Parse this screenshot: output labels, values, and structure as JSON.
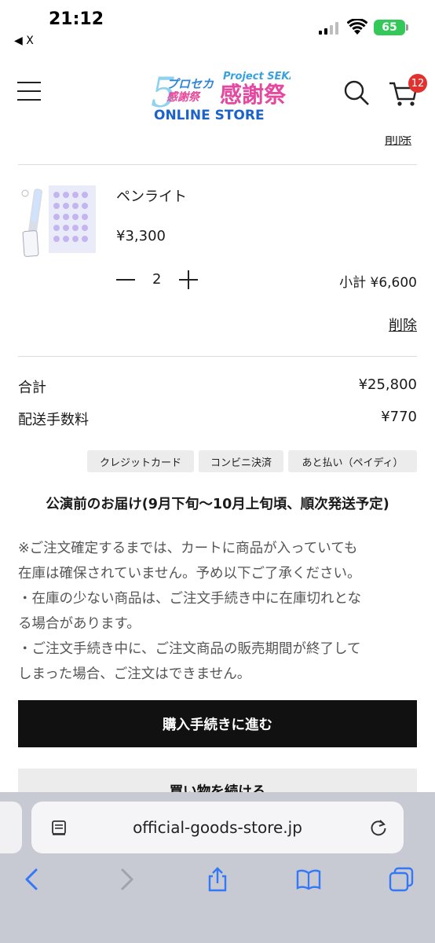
{
  "status_bar": {
    "time": "21:12",
    "back_app": "◀ X",
    "battery": "65"
  },
  "header": {
    "cart_count": "12",
    "logo_alt": "Project SEKAI 感謝祭 ONLINE STORE"
  },
  "partial_delete": "削除",
  "item": {
    "name": "ペンライト",
    "price": "¥3,300",
    "quantity": "2",
    "subtotal": "小計 ¥6,600",
    "delete": "削除"
  },
  "totals": [
    {
      "label": "合計",
      "value": "¥25,800"
    },
    {
      "label": "配送手数料",
      "value": "¥770"
    }
  ],
  "payment_methods": [
    "クレジットカード",
    "コンビニ決済",
    "あと払い（ペイディ）"
  ],
  "delivery_notice": "公演前のお届け(9月下旬〜10月上旬頃、順次発送予定)",
  "notice_lines": [
    "※ご注文確定するまでは、カートに商品が入っていても",
    "在庫は確保されていません。予め以下ご了承ください。",
    "・在庫の少ない商品は、ご注文手続き中に在庫切れとな",
    "る場合があります。",
    "・ご注文手続き中に、ご注文商品の販売期間が終了して",
    "しまった場合、ご注文はできません。"
  ],
  "buttons": {
    "checkout": "購入手続きに進む",
    "continue": "買い物を続ける"
  },
  "browser": {
    "url": "official-goods-store.jp"
  },
  "colors": {
    "accent_dark": "#111111",
    "badge_red": "#e0322e",
    "safari_blue": "#3478f6"
  }
}
